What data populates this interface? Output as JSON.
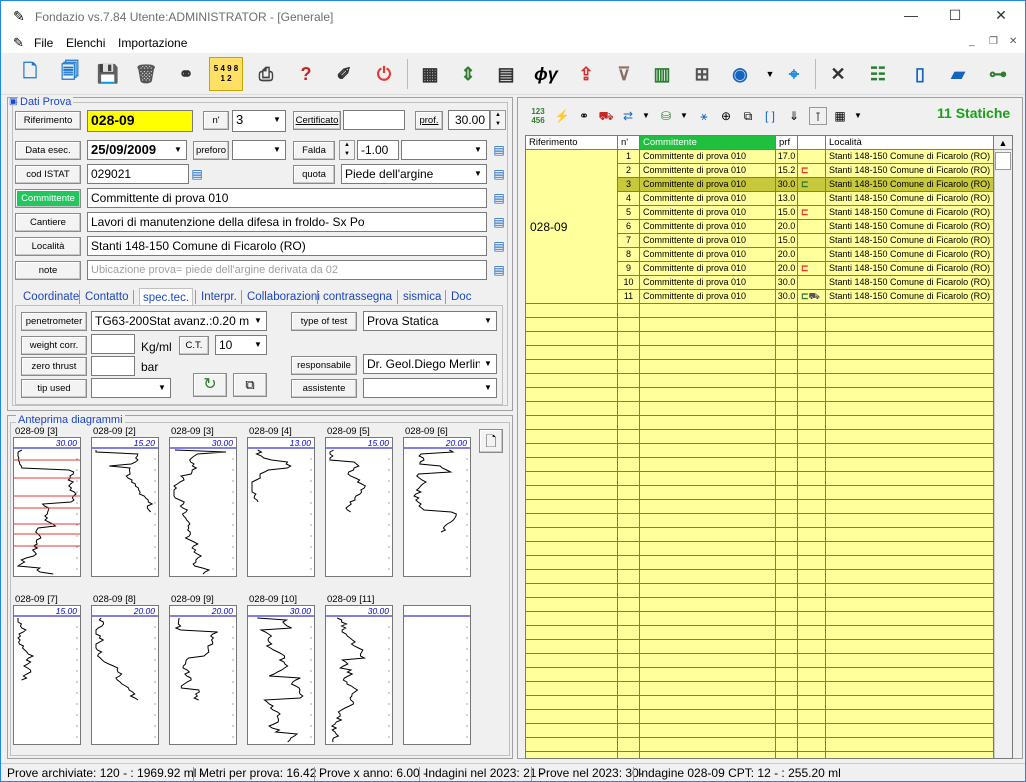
{
  "window": {
    "title": "Fondazio vs.7.84  Utente:ADMINISTRATOR - [Generale]"
  },
  "menu": [
    "File",
    "Elenchi",
    "Importazione"
  ],
  "toolbar_icons": [
    "new-doc-icon",
    "copy-doc-icon",
    "save-icon",
    "trash-icon",
    "binoculars-icon",
    "grid-numbers-icon",
    "printer-icon",
    "help-icon",
    "pencil-tools-icon",
    "power-icon",
    "calculator-icon",
    "layers-icon",
    "table-icon",
    "phi-gamma-icon",
    "upload-icon",
    "drill-icon",
    "bars-icon",
    "blocks-icon",
    "globe-icon",
    "map-icon",
    "tools-icon",
    "survey-icon",
    "building-icon",
    "city-icon",
    "network-icon"
  ],
  "toolbar_labels": {
    "numbers": "5 4 9 8 1 2",
    "phi": "ϕγ"
  },
  "dati_prova": {
    "title": "Dati Prova",
    "riferimento_btn": "Riferimento",
    "riferimento": "028-09",
    "n_btn": "n'",
    "n": "3",
    "certificato_btn": "Certificato",
    "certificato": "",
    "prof_btn": "prof.",
    "prof": "30.00",
    "data_btn": "Data esec.",
    "data": "25/09/2009",
    "preforo_btn": "preforo",
    "preforo": "",
    "falda_btn": "Falda",
    "falda": "-1.00",
    "istat_btn": "cod ISTAT",
    "istat": "029021",
    "quota_btn": "quota",
    "quota": "Piede dell'argine",
    "committente_btn": "Committente",
    "committente": "Committente di prova 010",
    "cantiere_btn": "Cantiere",
    "cantiere": "Lavori di manutenzione della difesa in froldo- Sx Po",
    "localita_btn": "Località",
    "localita": "Stanti 148-150 Comune di Ficarolo (RO)",
    "note_btn": "note",
    "note": "Ubicazione prova= piede dell'argine derivata da 02"
  },
  "tabs": [
    "Coordinate",
    "Contatto",
    "spec.tec.",
    "Interpr.",
    "Collaborazioni",
    "contrassegna",
    "sismica",
    "Doc"
  ],
  "spec": {
    "penetrometer_btn": "penetrometer",
    "penetrometer": "TG63-200Stat   avanz.:0.20 m",
    "weight_btn": "weight corr.",
    "weight": "",
    "weight_unit": "Kg/ml",
    "ct_btn": "C.T.",
    "ct": "10",
    "zero_btn": "zero thrust",
    "zero": "",
    "zero_unit": "bar",
    "tip_btn": "tip used",
    "tip": "",
    "type_btn": "type of test",
    "type": "Prova Statica",
    "resp_btn": "responsabile",
    "resp": "Dr. Geol.Diego Merlin",
    "assist_btn": "assistente",
    "assist": ""
  },
  "anteprima": {
    "title": "Anteprima diagrammi",
    "charts": [
      {
        "label": "028-09 [3]",
        "max": "30.00",
        "depth": 30.0,
        "red": true
      },
      {
        "label": "028-09 [2]",
        "max": "15.20",
        "depth": 15.2,
        "red": false
      },
      {
        "label": "028-09 [3]",
        "max": "30.00",
        "depth": 30.0,
        "red": false
      },
      {
        "label": "028-09 [4]",
        "max": "13.00",
        "depth": 13.0,
        "red": false
      },
      {
        "label": "028-09 [5]",
        "max": "15.00",
        "depth": 15.0,
        "red": false
      },
      {
        "label": "028-09 [6]",
        "max": "20.00",
        "depth": 20.0,
        "red": false
      },
      {
        "label": "028-09 [7]",
        "max": "15.00",
        "depth": 15.0,
        "red": false
      },
      {
        "label": "028-09 [8]",
        "max": "20.00",
        "depth": 20.0,
        "red": false
      },
      {
        "label": "028-09 [9]",
        "max": "20.00",
        "depth": 20.0,
        "red": false
      },
      {
        "label": "028-09 [10]",
        "max": "30.00",
        "depth": 30.0,
        "red": false
      },
      {
        "label": "028-09 [11]",
        "max": "30.00",
        "depth": 30.0,
        "red": false
      },
      {
        "label": "",
        "max": "",
        "depth": 0,
        "red": false
      }
    ]
  },
  "list": {
    "title": "11 Statiche",
    "headers": {
      "rif": "Riferimento",
      "n": "n'",
      "committente": "Committente",
      "prf": "prf",
      "flag": "",
      "localita": "Località"
    },
    "group": "028-09",
    "rows": [
      {
        "n": "1",
        "committente": "Committente di prova 010",
        "prf": "17.0",
        "flag": "",
        "localita": "Stanti 148-150 Comune di Ficarolo (RO)"
      },
      {
        "n": "2",
        "committente": "Committente di prova 010",
        "prf": "15.2",
        "flag": "red",
        "localita": "Stanti 148-150 Comune di Ficarolo (RO)"
      },
      {
        "n": "3",
        "committente": "Committente di prova 010",
        "prf": "30.0",
        "flag": "green",
        "localita": "Stanti 148-150 Comune di Ficarolo (RO)"
      },
      {
        "n": "4",
        "committente": "Committente di prova 010",
        "prf": "13.0",
        "flag": "",
        "localita": "Stanti 148-150 Comune di Ficarolo (RO)"
      },
      {
        "n": "5",
        "committente": "Committente di prova 010",
        "prf": "15.0",
        "flag": "red",
        "localita": "Stanti 148-150 Comune di Ficarolo (RO)"
      },
      {
        "n": "6",
        "committente": "Committente di prova 010",
        "prf": "20.0",
        "flag": "",
        "localita": "Stanti 148-150 Comune di Ficarolo (RO)"
      },
      {
        "n": "7",
        "committente": "Committente di prova 010",
        "prf": "15.0",
        "flag": "",
        "localita": "Stanti 148-150 Comune di Ficarolo (RO)"
      },
      {
        "n": "8",
        "committente": "Committente di prova 010",
        "prf": "20.0",
        "flag": "",
        "localita": "Stanti 148-150 Comune di Ficarolo (RO)"
      },
      {
        "n": "9",
        "committente": "Committente di prova 010",
        "prf": "20.0",
        "flag": "red",
        "localita": "Stanti 148-150 Comune di Ficarolo (RO)"
      },
      {
        "n": "10",
        "committente": "Committente di prova 010",
        "prf": "30.0",
        "flag": "",
        "localita": "Stanti 148-150 Comune di Ficarolo (RO)"
      },
      {
        "n": "11",
        "committente": "Committente di prova 010",
        "prf": "30.0",
        "flag": "green2",
        "localita": "Stanti 148-150 Comune di Ficarolo (RO)"
      }
    ],
    "selected_n": "3"
  },
  "status": [
    "Prove archiviate:  120 -  : 1969.92 ml -",
    "Metri per prova: 16.42 -",
    "Prove x anno: 6.00 -",
    "Indagini nel 2023: 21 -",
    "Prove nel 2023: 30-",
    "Indagine 028-09 CPT:  12 -  : 255.20 ml"
  ],
  "colors": {
    "accent": "#1a47c9",
    "highlight": "#ffff00",
    "grid_bg": "#ffff9c",
    "selected_row": "#c8c83c",
    "header_green": "#1fbf3f",
    "btn_green": "#22c55e"
  }
}
